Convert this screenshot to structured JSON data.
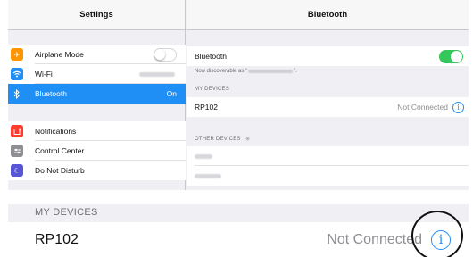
{
  "settings": {
    "title": "Settings",
    "group1": [
      {
        "label": "Airplane Mode",
        "icon": "airplane-icon",
        "control": "toggle-off"
      },
      {
        "label": "Wi-Fi",
        "icon": "wifi-icon",
        "control": "blurred-network-name"
      },
      {
        "label": "Bluetooth",
        "icon": "bluetooth-icon",
        "value": "On",
        "selected": true
      }
    ],
    "group2": [
      {
        "label": "Notifications",
        "icon": "notifications-icon"
      },
      {
        "label": "Control Center",
        "icon": "control-center-icon"
      },
      {
        "label": "Do Not Disturb",
        "icon": "moon-icon"
      }
    ]
  },
  "bluetooth": {
    "title": "Bluetooth",
    "toggle_label": "Bluetooth",
    "toggle_state": "on",
    "discoverable_prefix": "Now discoverable as “",
    "discoverable_suffix": "”.",
    "my_devices_header": "MY DEVICES",
    "device": {
      "name": "RP102",
      "status": "Not Connected",
      "info_icon": "info-icon"
    },
    "other_devices_header": "OTHER DEVICES",
    "other_devices_spinner": "activity-spinner-icon"
  },
  "zoom": {
    "header": "MY DEVICES",
    "device_name": "RP102",
    "status": "Not Connected"
  },
  "colors": {
    "accent": "#1f8ef5",
    "toggle_on": "#34c759",
    "airplane": "#ff9500",
    "notifications": "#ff3b30",
    "control_center": "#8e8e93",
    "do_not_disturb": "#5856d6"
  }
}
